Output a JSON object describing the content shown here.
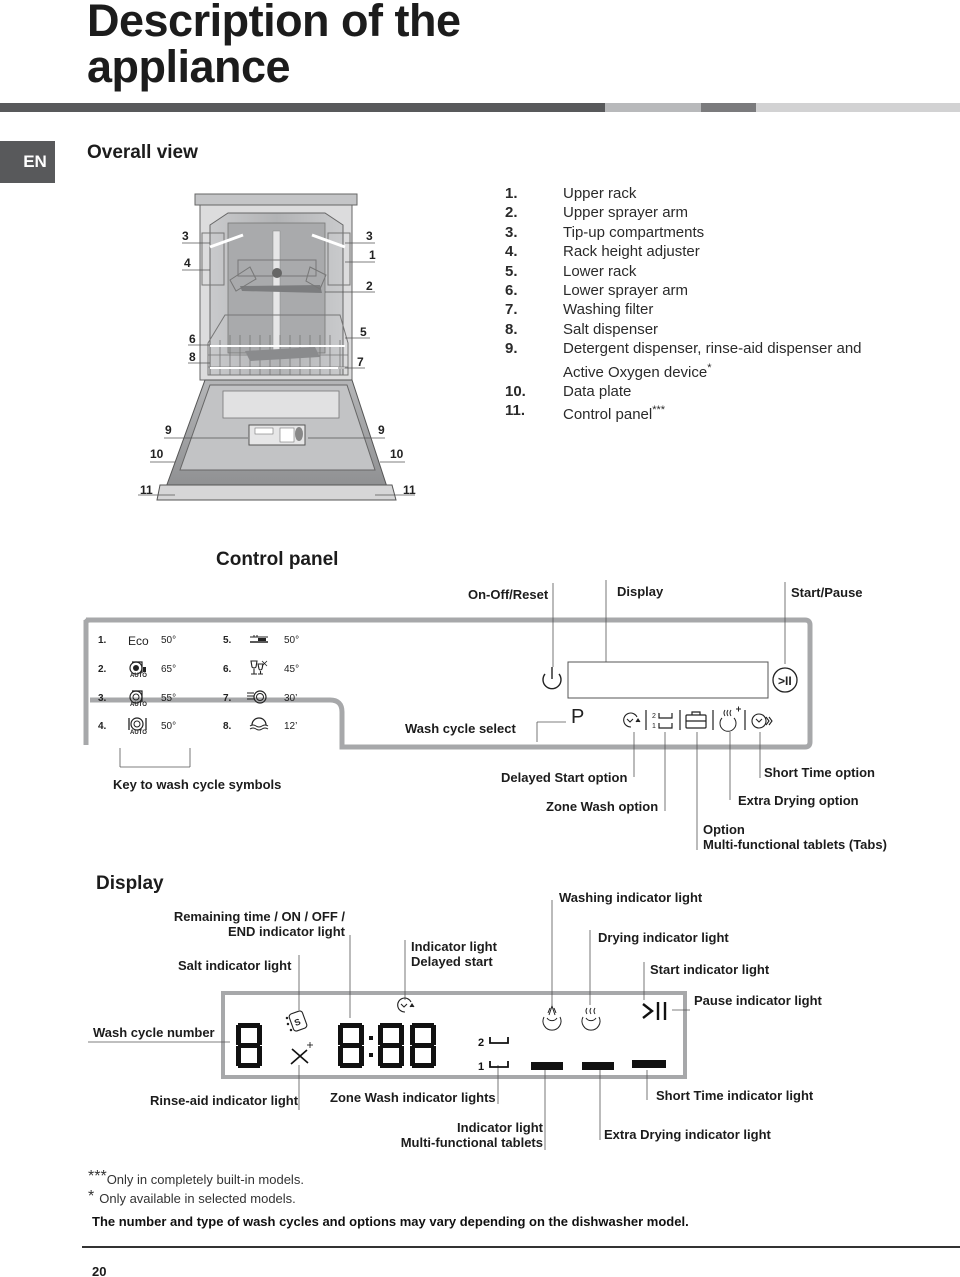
{
  "page": {
    "title_line1": "Description of the",
    "title_line2": "appliance",
    "language_tab": "EN",
    "page_number": "20"
  },
  "overall_view": {
    "heading": "Overall view",
    "callouts_left": [
      "3",
      "4",
      "6",
      "8",
      "9",
      "10",
      "11"
    ],
    "callouts_right": [
      "3",
      "1",
      "2",
      "5",
      "7",
      "9",
      "10",
      "11"
    ],
    "parts": [
      {
        "num": "1.",
        "label": "Upper rack"
      },
      {
        "num": "2.",
        "label": "Upper sprayer arm"
      },
      {
        "num": "3.",
        "label": "Tip-up compartments"
      },
      {
        "num": "4.",
        "label": "Rack height adjuster"
      },
      {
        "num": "5.",
        "label": "Lower rack"
      },
      {
        "num": "6.",
        "label": "Lower sprayer arm"
      },
      {
        "num": "7.",
        "label": "Washing filter"
      },
      {
        "num": "8.",
        "label": "Salt dispenser"
      },
      {
        "num": "9.",
        "label": "Detergent dispenser, rinse-aid dispenser and",
        "label2": "Active Oxygen device",
        "mark": "*"
      },
      {
        "num": "10.",
        "label": "Data plate"
      },
      {
        "num": "11.",
        "label": "Control panel",
        "mark": "***"
      }
    ]
  },
  "control_panel": {
    "heading": "Control panel",
    "labels": {
      "on_off": "On-Off/Reset",
      "display": "Display",
      "start_pause": "Start/Pause",
      "wash_cycle_select": "Wash cycle select",
      "key_symbols": "Key to wash cycle symbols",
      "delayed_start": "Delayed Start option",
      "zone_wash": "Zone Wash option",
      "short_time": "Short Time option",
      "extra_drying": "Extra Drying option",
      "tabs_line1": "Option",
      "tabs_line2": "Multi-functional tablets (Tabs)"
    },
    "program_button": "P",
    "cycles": [
      {
        "num": "1.",
        "symbol": "Eco",
        "icon": "eco-text",
        "temp": "50°"
      },
      {
        "num": "2.",
        "symbol": "AUTO",
        "icon": "auto-intensive-icon",
        "temp": "65°"
      },
      {
        "num": "3.",
        "symbol": "AUTO",
        "icon": "auto-normal-icon",
        "temp": "55°"
      },
      {
        "num": "4.",
        "symbol": "AUTO",
        "icon": "auto-plate-cutlery-icon",
        "temp": "50°"
      },
      {
        "num": "5.",
        "symbol": "",
        "icon": "half-load-rack-icon",
        "temp": "50°"
      },
      {
        "num": "6.",
        "symbol": "",
        "icon": "crystal-glass-icon",
        "temp": "45°"
      },
      {
        "num": "7.",
        "symbol": "",
        "icon": "express-plate-icon",
        "temp": "30’"
      },
      {
        "num": "8.",
        "symbol": "",
        "icon": "rinse-soak-icon",
        "temp": "12’"
      }
    ]
  },
  "display": {
    "heading": "Display",
    "labels": {
      "remaining_time_line1": "Remaining time / ON / OFF /",
      "remaining_time_line2": "END indicator light",
      "salt": "Salt indicator light",
      "delayed_line1": "Indicator light",
      "delayed_line2": "Delayed start",
      "washing": "Washing indicator light",
      "drying": "Drying indicator light",
      "start": "Start indicator light",
      "pause": "Pause indicator light",
      "wash_cycle_number": "Wash cycle number",
      "rinse_aid": "Rinse-aid indicator light",
      "zone_wash": "Zone Wash indicator lights",
      "tabs_line1": "Indicator light",
      "tabs_line2": "Multi-functional tablets",
      "short_time": "Short Time indicator light",
      "extra_drying": "Extra Drying indicator light"
    },
    "segments": {
      "cycle_digit": "8",
      "time": "8:88",
      "zone_upper": "2",
      "zone_lower": "1",
      "salt_letter": "S",
      "start_pause_glyph": ">II"
    }
  },
  "footnotes": {
    "note1_mark": "***",
    "note1": "Only in completely built-in models.",
    "note2_mark": "*",
    "note2": "Only available in selected models.",
    "disclaimer": "The number and type of wash cycles and options may vary depending on the dishwasher model."
  },
  "colors": {
    "dark_bar": "#58595b",
    "mid_bar": "#7b7b7d",
    "light_bar": "#b8b9bb",
    "pale_bar": "#d2d2d3",
    "panel_outline": "#a7a8aa"
  }
}
